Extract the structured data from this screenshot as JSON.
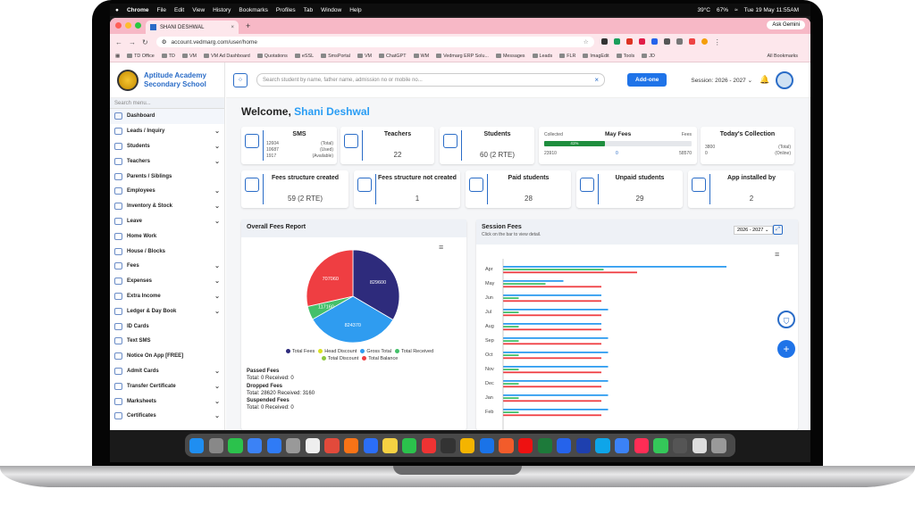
{
  "menubar": {
    "apple": "",
    "app": "Chrome",
    "items": [
      "File",
      "Edit",
      "View",
      "History",
      "Bookmarks",
      "Profiles",
      "Tab",
      "Window",
      "Help"
    ],
    "status": [
      "39°C",
      "67%",
      "Tue 19 May 11:55AM"
    ]
  },
  "browser": {
    "tab_title": "SHANI DESHWAL",
    "url": "account.vedmarg.com/user/home",
    "ask": "Ask Gemini",
    "bookmarks": [
      "TD Office",
      "TD",
      "VM",
      "VM Ad Dashboard",
      "Quotations",
      "eSSL",
      "SmsPortal",
      "VM",
      "ChatGPT",
      "WM",
      "Vedmarg ERP Solu...",
      "Messages",
      "Leads",
      "FLR",
      "ImagEdit",
      "Tools",
      "JD"
    ],
    "all_bookmarks": "All Bookmarks"
  },
  "school": {
    "name_line1": "Aptitude Academy",
    "name_line2": "Secondary School"
  },
  "sidebar": {
    "search_placeholder": "Search menu...",
    "items": [
      {
        "label": "Dashboard",
        "chev": ""
      },
      {
        "label": "Leads / Inquiry",
        "chev": "⌄"
      },
      {
        "label": "Students",
        "chev": "⌄"
      },
      {
        "label": "Teachers",
        "chev": "⌄"
      },
      {
        "label": "Parents / Siblings",
        "chev": ""
      },
      {
        "label": "Employees",
        "chev": "⌄"
      },
      {
        "label": "Inventory & Stock",
        "chev": "⌄"
      },
      {
        "label": "Leave",
        "chev": "⌄"
      },
      {
        "label": "Home Work",
        "chev": ""
      },
      {
        "label": "House / Blocks",
        "chev": ""
      },
      {
        "label": "Fees",
        "chev": "⌄"
      },
      {
        "label": "Expenses",
        "chev": "⌄"
      },
      {
        "label": "Extra Income",
        "chev": "⌄"
      },
      {
        "label": "Ledger & Day Book",
        "chev": "⌄"
      },
      {
        "label": "ID Cards",
        "chev": ""
      },
      {
        "label": "Text SMS",
        "chev": ""
      },
      {
        "label": "Notice On App [FREE]",
        "chev": ""
      },
      {
        "label": "Admit Cards",
        "chev": "⌄"
      },
      {
        "label": "Transfer Certificate",
        "chev": "⌄"
      },
      {
        "label": "Marksheets",
        "chev": "⌄"
      },
      {
        "label": "Certificates",
        "chev": "⌄"
      }
    ]
  },
  "topbar": {
    "search_placeholder": "Search student by name, father name, admission no or mobile no...",
    "add_label": "Add-one",
    "session": "Session: 2026 - 2027 ⌄"
  },
  "welcome": {
    "prefix": "Welcome,",
    "name": "Shani Deshwal"
  },
  "cards1": {
    "sms": {
      "title": "SMS",
      "total": "12604",
      "used": "10687",
      "avail": "1917",
      "total_l": "(Total)",
      "used_l": "(Used)",
      "avail_l": "(Available)"
    },
    "teachers": {
      "title": "Teachers",
      "value": "22"
    },
    "students": {
      "title": "Students",
      "value": "60  (2 RTE)"
    },
    "fees": {
      "collected_l": "Collected",
      "title": "May Fees",
      "fees_l": "Fees",
      "pct": "41%",
      "progress": 0.41,
      "collected": "23910",
      "mid": "0",
      "fees": "58570"
    },
    "today": {
      "title": "Today's Collection",
      "v1": "3800",
      "v2": "0",
      "l1": "(Total)",
      "l2": "(Online)"
    }
  },
  "cards2": [
    {
      "title": "Fees structure created",
      "value": "59  (2 RTE)"
    },
    {
      "title": "Fees structure not created",
      "value": "1"
    },
    {
      "title": "Paid students",
      "value": "28"
    },
    {
      "title": "Unpaid students",
      "value": "29"
    },
    {
      "title": "App installed by",
      "value": "2"
    }
  ],
  "report": {
    "title": "Overall Fees Report",
    "legend": [
      {
        "label": "Total Fees",
        "color": "#2e2b7c"
      },
      {
        "label": "Head Discount",
        "color": "#d9e021"
      },
      {
        "label": "Gross Total",
        "color": "#2f9cf0"
      },
      {
        "label": "Total Received",
        "color": "#44c06a"
      },
      {
        "label": "Total Discount",
        "color": "#8dc63f"
      },
      {
        "label": "Total Balance",
        "color": "#ef3e42"
      }
    ],
    "passed": "Passed Fees",
    "passed_l": "Total: 0   Received: 0",
    "dropped": "Dropped Fees",
    "dropped_l": "Total: 28620   Received: 3160",
    "susp": "Suspended Fees",
    "susp_l": "Total: 0   Received: 0"
  },
  "session_fees": {
    "title": "Session Fees",
    "subtitle": "Click on the bar to view detail.",
    "year": "2026 - 2027 ⌄"
  },
  "chart_data": [
    {
      "type": "pie",
      "title": "",
      "slices": [
        {
          "label": "Total Fees",
          "value": 829600,
          "color": "#2e2b7c"
        },
        {
          "label": "Gross Total",
          "value": 824370,
          "color": "#2f9cf0"
        },
        {
          "label": "Total Received",
          "value": 117160,
          "color": "#44c06a"
        },
        {
          "label": "Total Balance",
          "value": 707060,
          "color": "#ef3e42"
        }
      ]
    },
    {
      "type": "bar",
      "orientation": "horizontal",
      "categories": [
        "Apr",
        "May",
        "Jun",
        "Jul",
        "Aug",
        "Sep",
        "Oct",
        "Nov",
        "Dec",
        "Jan",
        "Feb"
      ],
      "series": [
        {
          "color": "#2f9cf0",
          "values": [
            100,
            27,
            44,
            47,
            44,
            47,
            47,
            47,
            47,
            47,
            47
          ]
        },
        {
          "color": "#44c06a",
          "values": [
            45,
            19,
            7,
            7,
            7,
            7,
            7,
            7,
            7,
            7,
            7
          ]
        },
        {
          "color": "#ef3e42",
          "values": [
            60,
            44,
            44,
            44,
            44,
            44,
            44,
            44,
            44,
            44,
            44
          ]
        }
      ]
    }
  ],
  "dock_colors": [
    "#1f8ef1",
    "#888",
    "#2bc24c",
    "#3b82f6",
    "#2f7bf6",
    "#999",
    "#eee",
    "#e24a3b",
    "#f97316",
    "#2b6ef7",
    "#f5d142",
    "#2bc24c",
    "#e33",
    "#333",
    "#f4b400",
    "#1a73e8",
    "#f25c2b",
    "#e11",
    "#1d7a3a",
    "#2563eb",
    "#1e40af",
    "#0ea5e9",
    "#3b82f6",
    "#ff2d55",
    "#34c759",
    "#555",
    "#ddd",
    "#999"
  ]
}
